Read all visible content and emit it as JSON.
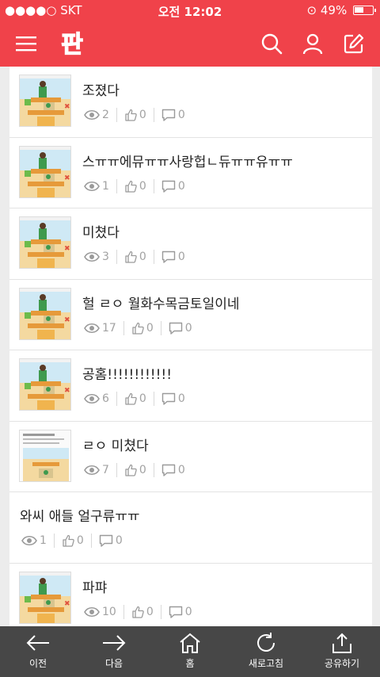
{
  "status_bar": {
    "carrier": "●●●●○ SKT",
    "time": "오전 12:02",
    "battery": "49%"
  },
  "app_bar": {
    "logo_text": "판"
  },
  "feed": [
    {
      "title": "조졌다",
      "views": "2",
      "likes": "0",
      "comments": "0",
      "thumb": "comic"
    },
    {
      "title": "스ㅠㅠ에뮤ㅠㅠ사랑헙ㄴ듀ㅠㅠ유ㅠㅠ",
      "views": "1",
      "likes": "0",
      "comments": "0",
      "thumb": "comic"
    },
    {
      "title": "미쳤다",
      "views": "3",
      "likes": "0",
      "comments": "0",
      "thumb": "comic"
    },
    {
      "title": "헐 ㄹㅇ 월화수목금토일이네",
      "views": "17",
      "likes": "0",
      "comments": "0",
      "thumb": "comic"
    },
    {
      "title": "공홈!!!!!!!!!!!!",
      "views": "6",
      "likes": "0",
      "comments": "0",
      "thumb": "comic"
    },
    {
      "title": "ㄹㅇ 미쳤다",
      "views": "7",
      "likes": "0",
      "comments": "0",
      "thumb": "screenshot"
    },
    {
      "title": "와씨 애들 얼구류ㅠㅠ",
      "views": "1",
      "likes": "0",
      "comments": "0",
      "thumb": "none"
    },
    {
      "title": "파퍄",
      "views": "10",
      "likes": "0",
      "comments": "0",
      "thumb": "comic"
    }
  ],
  "bottom_nav": [
    {
      "label": "이전",
      "icon": "arrow-left-icon"
    },
    {
      "label": "다음",
      "icon": "arrow-right-icon"
    },
    {
      "label": "홈",
      "icon": "home-icon"
    },
    {
      "label": "새로고침",
      "icon": "refresh-icon"
    },
    {
      "label": "공유하기",
      "icon": "share-icon"
    }
  ],
  "colors": {
    "brand": "#f0424a",
    "bottom_bar": "#474747",
    "meta": "#a2a2a2"
  }
}
